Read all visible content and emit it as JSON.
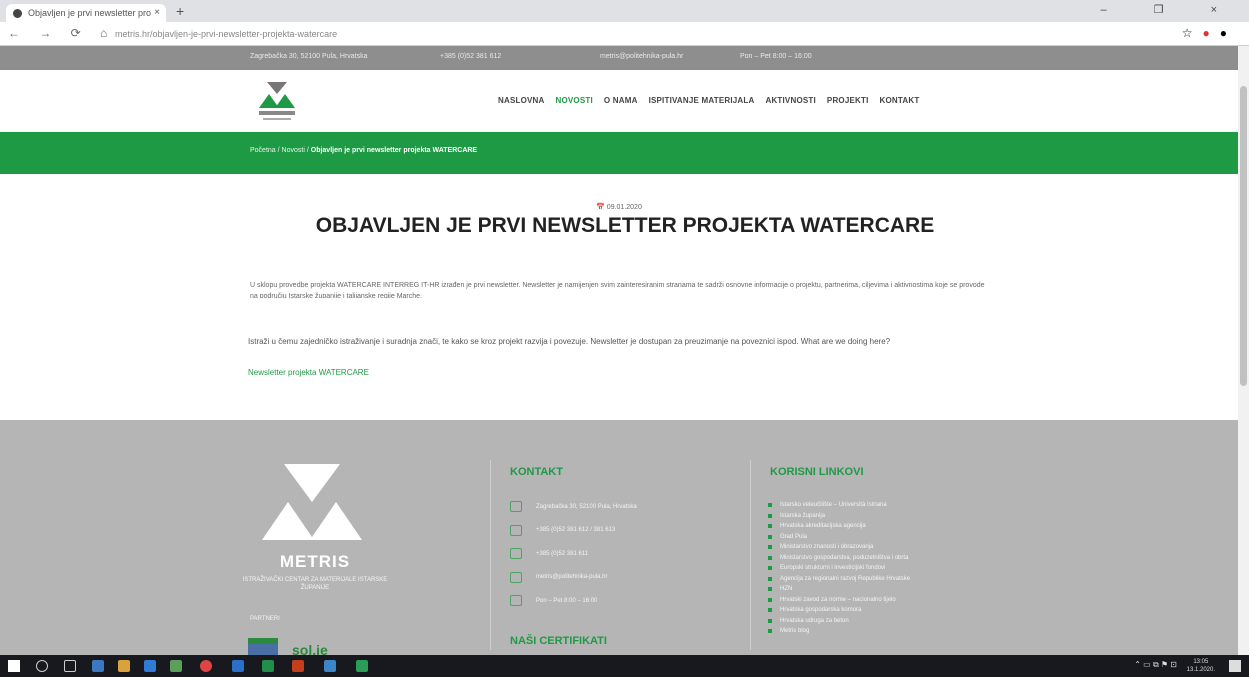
{
  "browser": {
    "tab_title": "Objavljen je prvi newsletter pro",
    "tab_close": "×",
    "new_tab": "+",
    "nav_buttons": "← → ⟳ ⌂",
    "url": "metris.hr/objavljen-je-prvi-newsletter-projekta-watercare",
    "window_controls": "– ❐ ×"
  },
  "topbar": {
    "address": "Zagrebačka 30, 52100 Pula, Hrvatska",
    "phone": "+385 (0)52 381 612",
    "email": "metris@politehnika-pula.hr",
    "hours": "Pon – Pet 8:00 – 16:00"
  },
  "nav": {
    "items": [
      "NASLOVNA",
      "NOVOSTI",
      "O NAMA",
      "ISPITIVANJE MATERIJALA",
      "AKTIVNOSTI",
      "PROJEKTI",
      "KONTAKT"
    ],
    "active_index": 1
  },
  "breadcrumb": {
    "home": "Početna",
    "sep": "/",
    "section": "Novosti",
    "current": "Objavljen je prvi newsletter projekta WATERCARE"
  },
  "article": {
    "date": "📅 09.01.2020",
    "title": "OBJAVLJEN JE PRVI NEWSLETTER PROJEKTA WATERCARE",
    "para1": "U sklopu provedbe projekta WATERCARE INTERREG IT-HR izrađen je prvi newsletter. Newsletter je namijenjen svim zainteresiranim stranama te sadrži osnovne informacije o projektu, partnerima, ciljevima i aktivnostima koje se provode na području Istarske županije i talijanske regije Marche.",
    "para2": "Istraži u čemu zajedničko istraživanje i suradnja znači, te kako se kroz projekt razvija i povezuje. Newsletter je dostupan za preuzimanje na poveznici ispod. What are we doing here?",
    "link": "Newsletter projekta WATERCARE"
  },
  "footer": {
    "brand": "METRIS",
    "subtitle": "ISTRAŽIVAČKI CENTAR ZA MATERIJALE ISTARSKE ŽUPANIJE",
    "partners_label": "PARTNERI",
    "partner2": "sol.ie",
    "contact_heading": "KONTAKT",
    "contacts": [
      "Zagrebačka 30, 52100 Pula, Hrvatska",
      "+385 (0)52 381 612 / 381 613",
      "+385 (0)52 381 611",
      "metris@politehnika-pula.hr",
      "Pon – Pet 8:00 – 16:00"
    ],
    "cert_heading": "NAŠI CERTIFIKATI",
    "links_heading": "KORISNI LINKOVI",
    "links": [
      "Istarsko veleučilište – Università Istriana",
      "Istarska županija",
      "Hrvatska akreditacijska agencija",
      "Grad Pula",
      "Ministarstvo znanosti i obrazovanja",
      "Ministarstvo gospodarstva, poduzetništva i obrta",
      "Europski strukturni i investicijski fondovi",
      "Agencija za regionalni razvoj Republike Hrvatske",
      "HZN",
      "Hrvatski zavod za norme – nacionalno tijelo",
      "Hrvatska gospodarska komora",
      "Hrvatska udruga za beton",
      "Metris blog"
    ]
  },
  "taskbar": {
    "tray": "⌃ ▭ ⧉ ⚑ ⊡",
    "time": "13:05",
    "date": "13.1.2020."
  },
  "colors": {
    "brand_green": "#1e9a45",
    "topbar_grey": "#8e8e8e",
    "footer_grey": "#b5b5b5",
    "taskbar": "#17191f"
  }
}
